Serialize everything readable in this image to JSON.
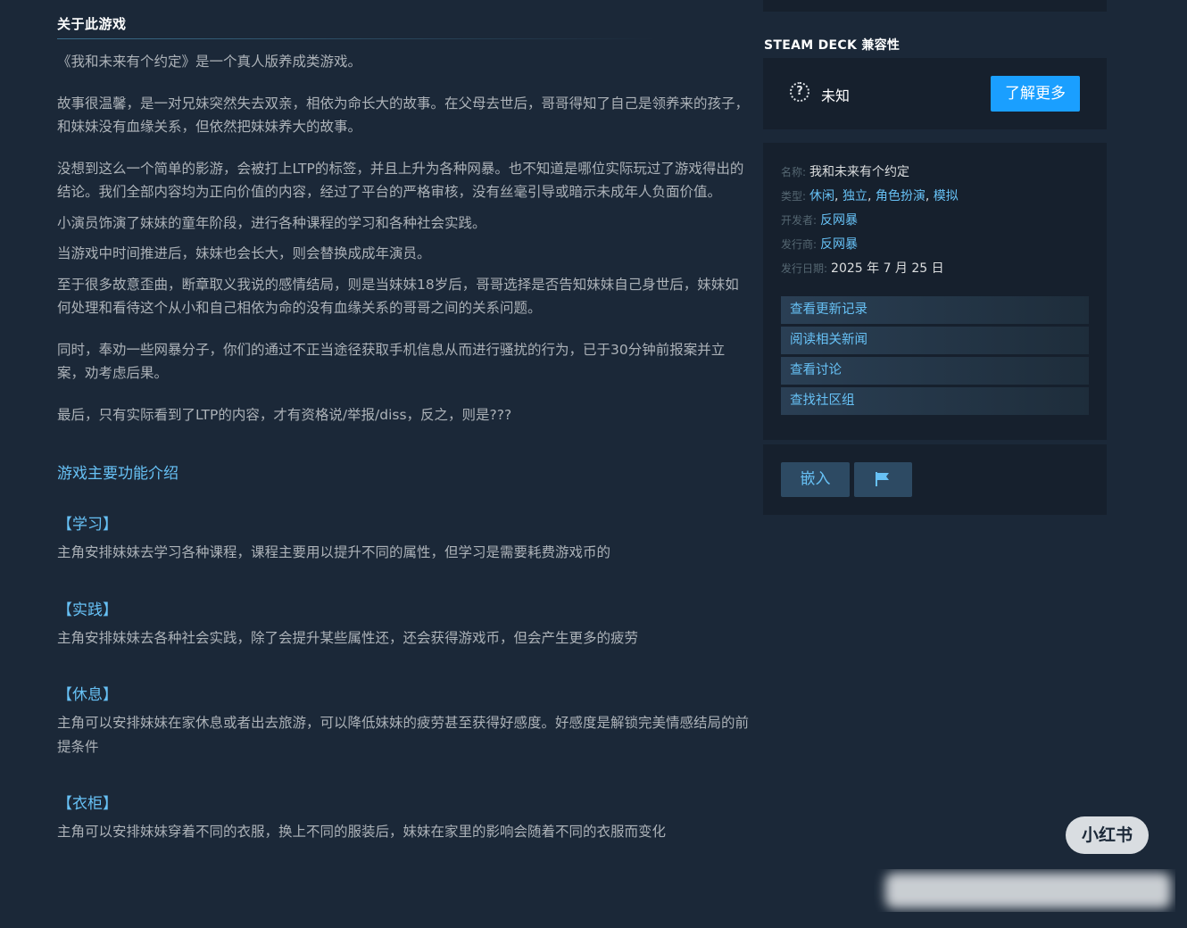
{
  "about": {
    "title": "关于此游戏",
    "paragraphs": [
      "《我和未来有个约定》是一个真人版养成类游戏。",
      "故事很温馨，是一对兄妹突然失去双亲，相依为命长大的故事。在父母去世后，哥哥得知了自己是领养来的孩子，和妹妹没有血缘关系，但依然把妹妹养大的故事。",
      "没想到这么一个简单的影游，会被打上LTP的标签，并且上升为各种网暴。也不知道是哪位实际玩过了游戏得出的结论。我们全部内容均为正向价值的内容，经过了平台的严格审核，没有丝毫引导或暗示未成年人负面价值。",
      "小演员饰演了妹妹的童年阶段，进行各种课程的学习和各种社会实践。",
      "当游戏中时间推进后，妹妹也会长大，则会替换成成年演员。",
      "至于很多故意歪曲，断章取义我说的感情结局，则是当妹妹18岁后，哥哥选择是否告知妹妹自己身世后，妹妹如何处理和看待这个从小和自己相依为命的没有血缘关系的哥哥之间的关系问题。",
      "同时，奉劝一些网暴分子，你们的通过不正当途径获取手机信息从而进行骚扰的行为，已于30分钟前报案并立案，劝考虑后果。",
      "最后，只有实际看到了LTP的内容，才有资格说/举报/diss，反之，则是???"
    ],
    "features_heading": "游戏主要功能介绍",
    "features": [
      {
        "name": "【学习】",
        "desc": "主角安排妹妹去学习各种课程，课程主要用以提升不同的属性，但学习是需要耗费游戏币的"
      },
      {
        "name": "【实践】",
        "desc": "主角安排妹妹去各种社会实践，除了会提升某些属性还，还会获得游戏币，但会产生更多的疲劳"
      },
      {
        "name": "【休息】",
        "desc": "主角可以安排妹妹在家休息或者出去旅游，可以降低妹妹的疲劳甚至获得好感度。好感度是解锁完美情感结局的前提条件"
      },
      {
        "name": "【衣柜】",
        "desc": "主角可以安排妹妹穿着不同的衣服，换上不同的服装后，妹妹在家里的影响会随着不同的衣服而变化"
      }
    ]
  },
  "deck": {
    "title": "STEAM DECK 兼容性",
    "status": "未知",
    "learn_more": "了解更多"
  },
  "info": {
    "name_label": "名称:",
    "name": "我和未来有个约定",
    "genre_label": "类型:",
    "genres": [
      "休闲",
      "独立",
      "角色扮演",
      "模拟"
    ],
    "developer_label": "开发者:",
    "developer": "反网暴",
    "publisher_label": "发行商:",
    "publisher": "反网暴",
    "release_label": "发行日期:",
    "release": "2025 年 7 月 25 日",
    "buttons": [
      "查看更新记录",
      "阅读相关新闻",
      "查看讨论",
      "查找社区组"
    ]
  },
  "share": {
    "embed": "嵌入",
    "flag_icon": "flag-icon"
  },
  "badge": "小红书"
}
